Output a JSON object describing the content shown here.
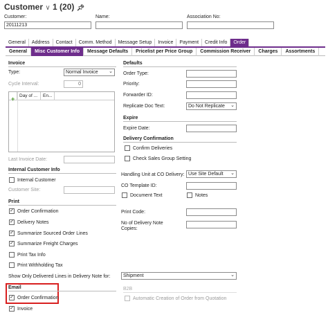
{
  "header": {
    "title": "Customer",
    "record": "1 (20)",
    "fields": [
      {
        "label": "Customer:",
        "value": "20111213"
      },
      {
        "label": "Name:",
        "value": ""
      },
      {
        "label": "Association No:",
        "value": ""
      }
    ]
  },
  "tabs": [
    "General",
    "Address",
    "Contact",
    "Comm. Method",
    "Message Setup",
    "Invoice",
    "Payment",
    "Credit Info",
    "Order"
  ],
  "subtabs": [
    "General",
    "Misc Customer Info",
    "Message Defaults",
    "Pricelist per Price Group",
    "Commission Receiver",
    "Charges",
    "Assortments"
  ],
  "invoice": {
    "section": "Invoice",
    "type_label": "Type:",
    "type_value": "Normal Invoice",
    "cycle_label": "Cycle Interval:",
    "cycle_value": "0",
    "col1": "Day of ...",
    "col2": "En...",
    "last_label": "Last Invoice Date:"
  },
  "internal": {
    "section": "Internal Customer Info",
    "cb_label": "Internal Customer",
    "site_label": "Customer Site:"
  },
  "print": {
    "section": "Print",
    "items": [
      {
        "label": "Order Confirmation",
        "checked": "✓"
      },
      {
        "label": "Delivery Notes",
        "checked": "✓"
      },
      {
        "label": "Summarize Sourced Order Lines",
        "checked": "✓"
      },
      {
        "label": "Summarize Freight Charges",
        "checked": "✓"
      },
      {
        "label": "Print Tax Info",
        "checked": ""
      },
      {
        "label": "Print Withholding Tax",
        "checked": ""
      }
    ],
    "show_label": "Show Only Delivered Lines in Delivery Note for:",
    "show_value": "Shipment"
  },
  "email": {
    "section": "Email",
    "items": [
      {
        "label": "Order Confirmation",
        "checked": "✓"
      },
      {
        "label": "Invoice",
        "checked": "✓"
      }
    ]
  },
  "defaults": {
    "section": "Defaults",
    "fields": [
      "Order Type:",
      "Priority:",
      "Forwarder ID:"
    ],
    "replicate_label": "Replicate Doc Text:",
    "replicate_value": "Do Not Replicate"
  },
  "expire": {
    "section": "Expire",
    "label": "Expire Date:"
  },
  "delivery": {
    "section": "Delivery Confirmation",
    "items": [
      "Confirm Deliveries",
      "Check Sales Group Setting"
    ]
  },
  "handling": {
    "label": "Handling Unit at CO Delivery:",
    "value": "Use Site Default",
    "template_label": "CO Template ID:",
    "doc_text": "Document Text",
    "notes": "Notes"
  },
  "printcode": {
    "label": "Print Code:",
    "copies_label_1": "No of Delivery Note",
    "copies_label_2": "Copies:"
  },
  "b2b": {
    "section": "B2B",
    "item": "Automatic Creation of Order from Quotation"
  }
}
